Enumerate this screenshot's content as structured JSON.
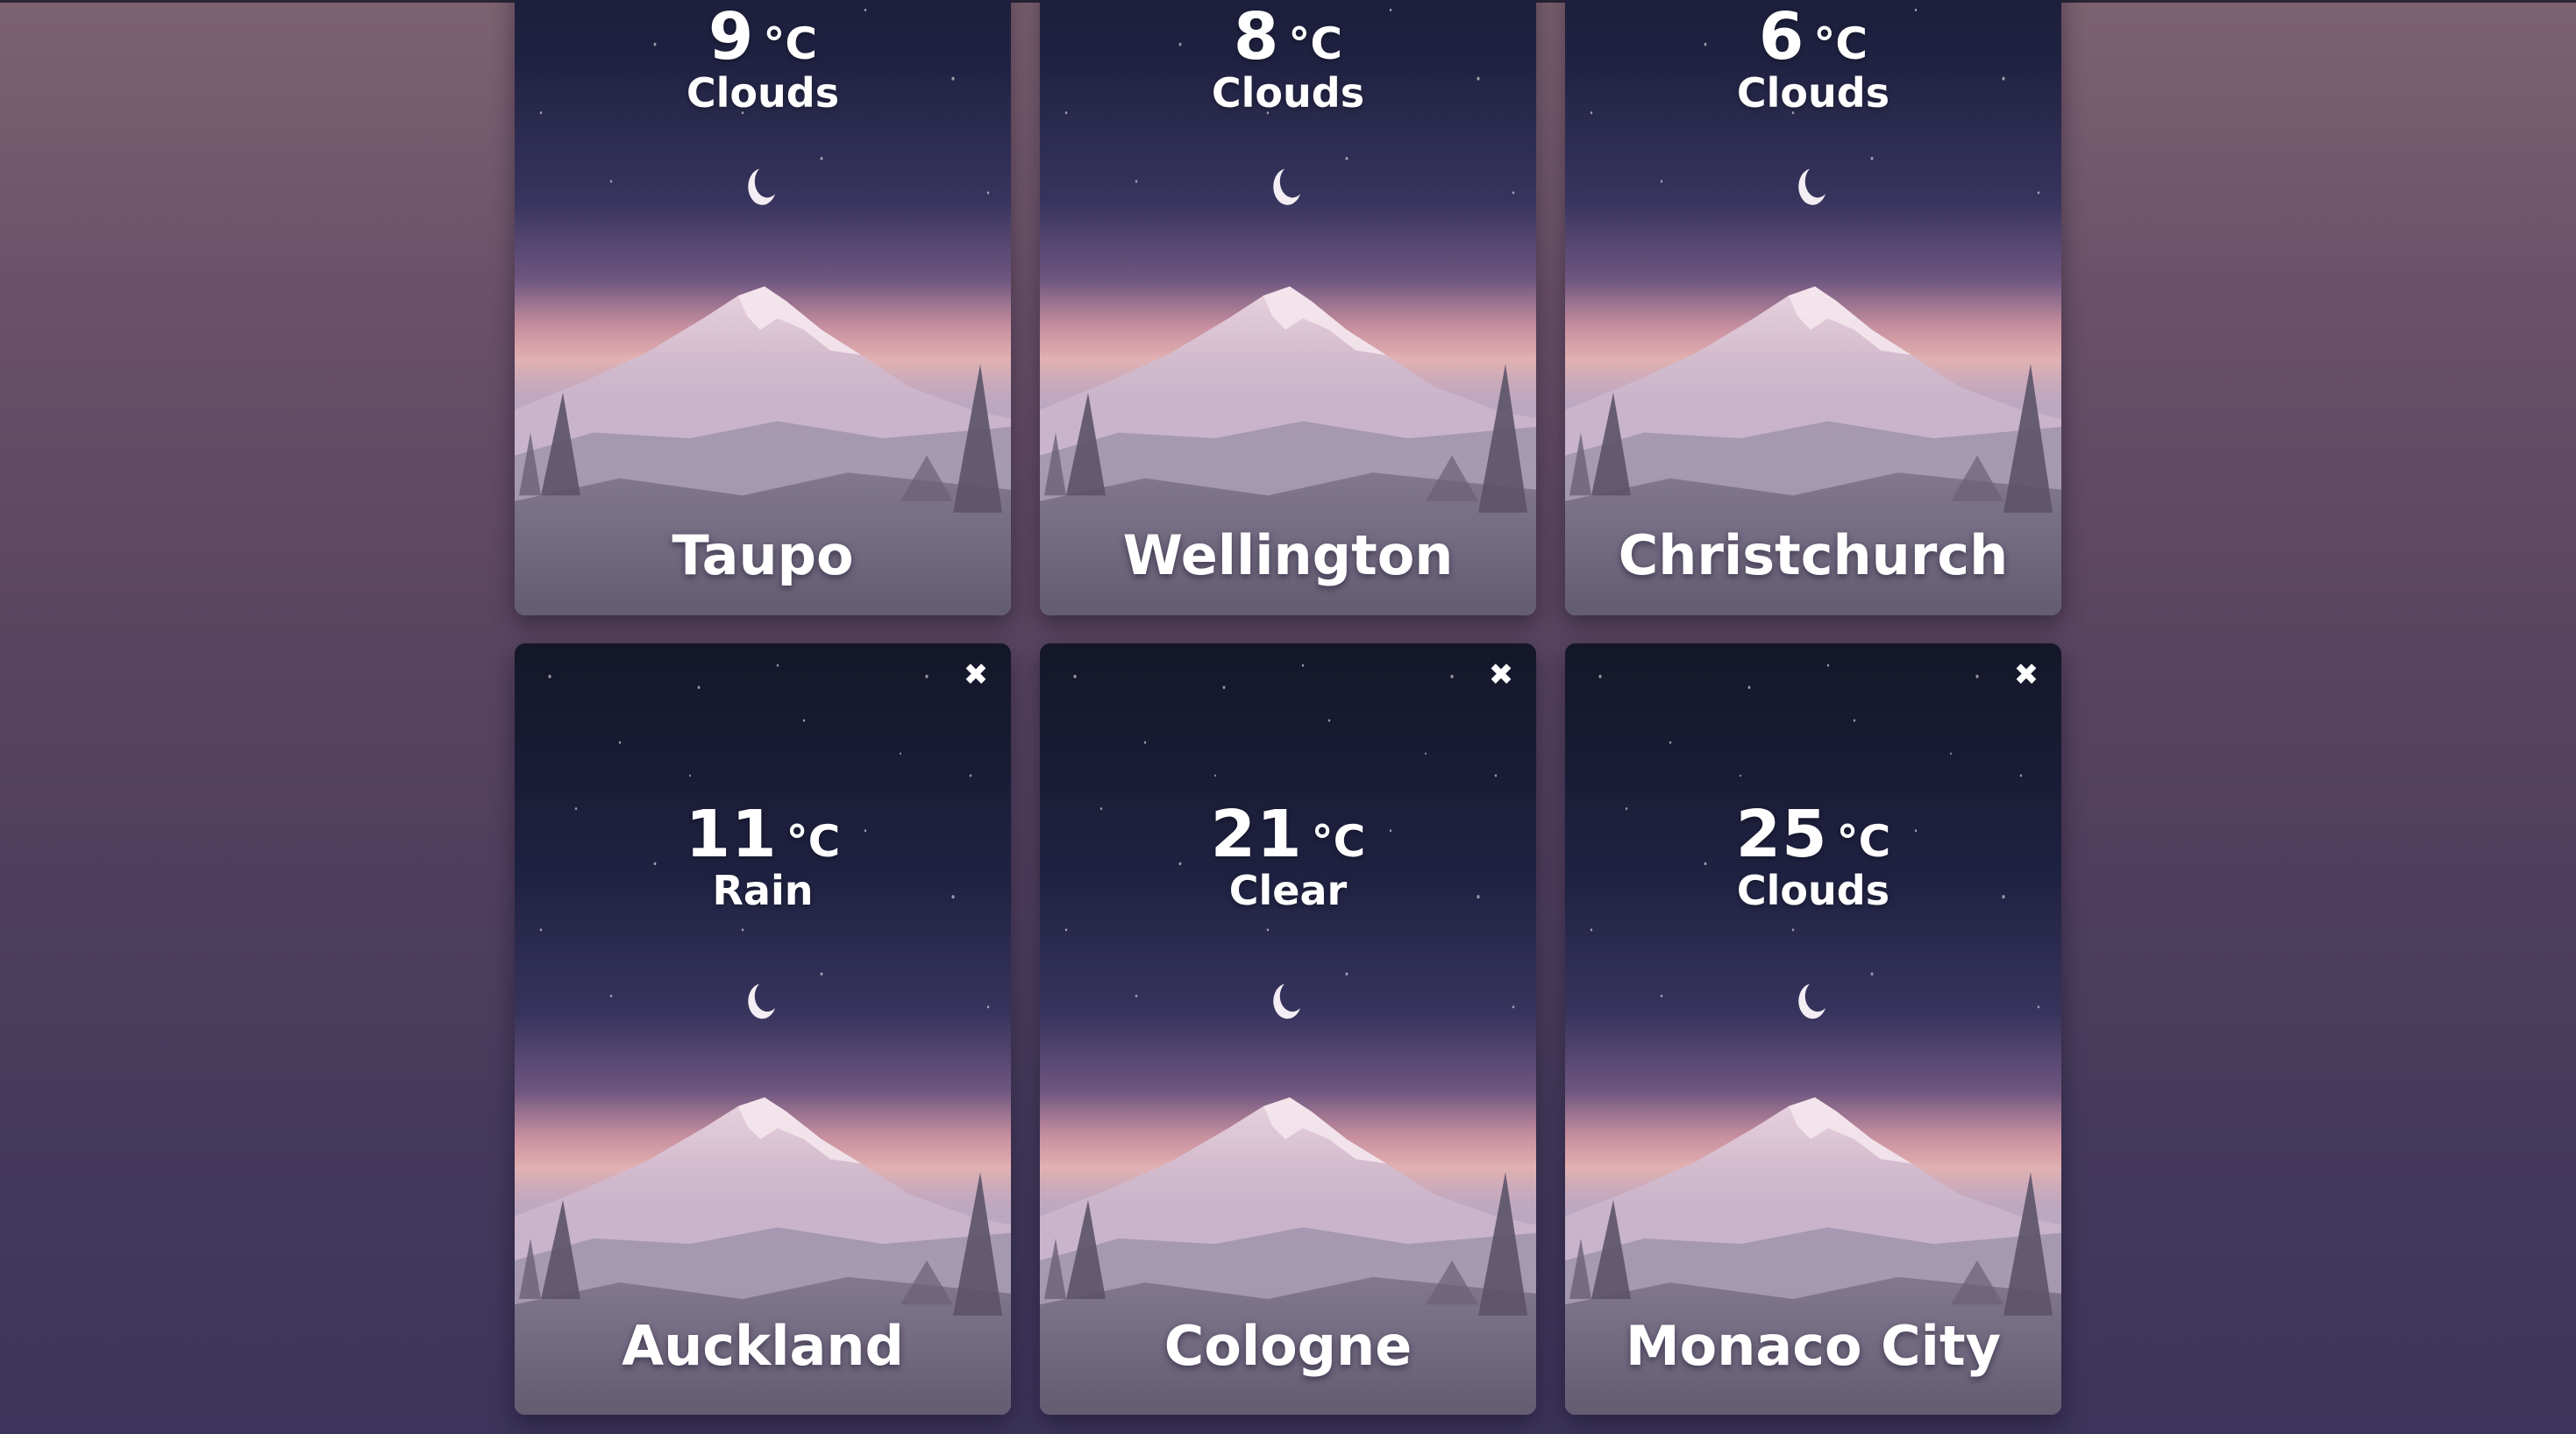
{
  "cards": [
    {
      "temp": "9",
      "unit": "°C",
      "condition": "Clouds",
      "city": "Taupo",
      "removable": false
    },
    {
      "temp": "8",
      "unit": "°C",
      "condition": "Clouds",
      "city": "Wellington",
      "removable": false
    },
    {
      "temp": "6",
      "unit": "°C",
      "condition": "Clouds",
      "city": "Christchurch",
      "removable": false
    },
    {
      "temp": "11",
      "unit": "°C",
      "condition": "Rain",
      "city": "Auckland",
      "removable": true
    },
    {
      "temp": "21",
      "unit": "°C",
      "condition": "Clear",
      "city": "Cologne",
      "removable": true
    },
    {
      "temp": "25",
      "unit": "°C",
      "condition": "Clouds",
      "city": "Monaco City",
      "removable": true
    }
  ],
  "icons": {
    "close": "close-icon",
    "moon": "crescent-moon-icon"
  },
  "colors": {
    "sky_top": "#141629",
    "sky_mid": "#3a3762",
    "horizon": "#d9a6b4",
    "mist": "#cbbcd3",
    "text": "#ffffff"
  }
}
